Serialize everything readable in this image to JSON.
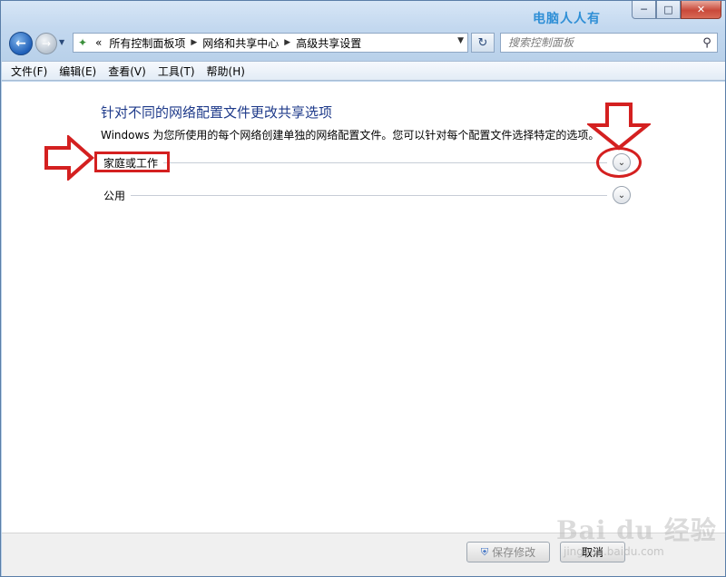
{
  "window": {
    "watermark_title": "电脑人人有",
    "minimize_glyph": "─",
    "maximize_glyph": "□",
    "close_glyph": "✕"
  },
  "nav": {
    "back_glyph": "←",
    "forward_glyph": "→",
    "dropdown_glyph": "▼",
    "address": {
      "overflow": "«",
      "crumbs": [
        "所有控制面板项",
        "网络和共享中心",
        "高级共享设置"
      ],
      "separator": "▶",
      "dropdown_glyph": "▼"
    },
    "refresh_glyph": "↻",
    "search_placeholder": "搜索控制面板",
    "search_glyph": "⚲"
  },
  "menu": {
    "items": [
      "文件(F)",
      "编辑(E)",
      "查看(V)",
      "工具(T)",
      "帮助(H)"
    ]
  },
  "content": {
    "heading": "针对不同的网络配置文件更改共享选项",
    "description": "Windows 为您所使用的每个网络创建单独的网络配置文件。您可以针对每个配置文件选择特定的选项。",
    "sections": [
      {
        "label": "家庭或工作"
      },
      {
        "label": "公用"
      }
    ],
    "expand_glyph": "⌄"
  },
  "footer": {
    "save_label": "保存修改",
    "cancel_label": "取消"
  },
  "annotations": {
    "color": "#d42020"
  },
  "watermark": {
    "brand": "Bai du 经验",
    "url": "jingyan.baidu.com"
  }
}
